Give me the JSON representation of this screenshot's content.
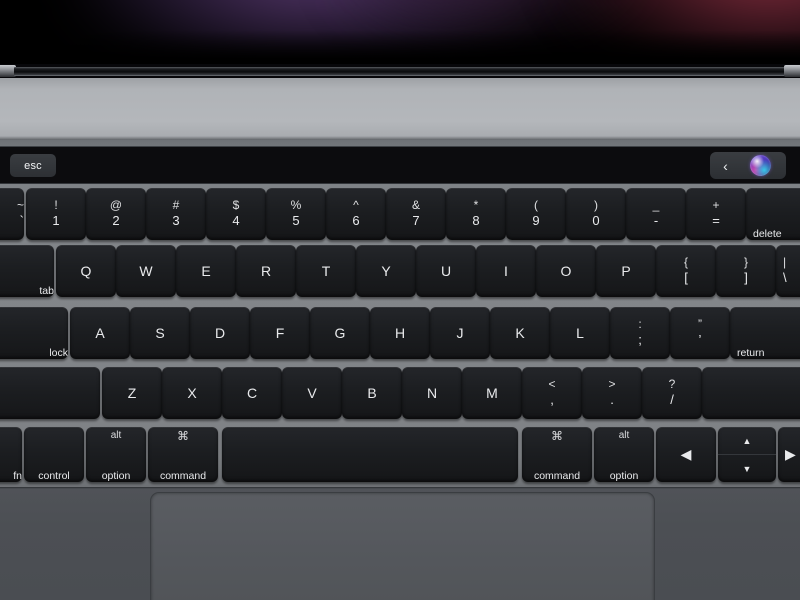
{
  "device": {
    "name": "MacBook Pro with Touch Bar",
    "screen_glow_colors": {
      "purple": "#603e78",
      "red": "#963446",
      "background": "#000000"
    },
    "body_color": "#b0b3b7",
    "deck_color": "#83868a",
    "trackpad_color": "#5a5d62"
  },
  "touchbar": {
    "esc_label": "esc",
    "back_chevron": "‹",
    "siri_label": "Siri"
  },
  "keyboard": {
    "rows": [
      {
        "name": "number-row",
        "keys": [
          {
            "name": "grave",
            "top": "~",
            "bottom": "`",
            "style": "dual",
            "clip": "left"
          },
          {
            "name": "1",
            "top": "!",
            "bottom": "1",
            "style": "dual"
          },
          {
            "name": "2",
            "top": "@",
            "bottom": "2",
            "style": "dual"
          },
          {
            "name": "3",
            "top": "#",
            "bottom": "3",
            "style": "dual"
          },
          {
            "name": "4",
            "top": "$",
            "bottom": "4",
            "style": "dual"
          },
          {
            "name": "5",
            "top": "%",
            "bottom": "5",
            "style": "dual"
          },
          {
            "name": "6",
            "top": "^",
            "bottom": "6",
            "style": "dual"
          },
          {
            "name": "7",
            "top": "&",
            "bottom": "7",
            "style": "dual"
          },
          {
            "name": "8",
            "top": "*",
            "bottom": "8",
            "style": "dual"
          },
          {
            "name": "9",
            "top": "(",
            "bottom": "9",
            "style": "dual"
          },
          {
            "name": "0",
            "top": ")",
            "bottom": "0",
            "style": "dual"
          },
          {
            "name": "minus",
            "top": "_",
            "bottom": "-",
            "style": "dual"
          },
          {
            "name": "equal",
            "top": "+",
            "bottom": "=",
            "style": "dual"
          },
          {
            "name": "delete",
            "top": "",
            "bottom": "delete",
            "style": "mod",
            "clip": "right"
          }
        ]
      },
      {
        "name": "top-letter-row",
        "keys": [
          {
            "name": "tab",
            "top": "",
            "bottom": "tab",
            "style": "mod",
            "clip": "left"
          },
          {
            "name": "q",
            "top": "",
            "bottom": "Q",
            "style": "single"
          },
          {
            "name": "w",
            "top": "",
            "bottom": "W",
            "style": "single"
          },
          {
            "name": "e",
            "top": "",
            "bottom": "E",
            "style": "single"
          },
          {
            "name": "r",
            "top": "",
            "bottom": "R",
            "style": "single"
          },
          {
            "name": "t",
            "top": "",
            "bottom": "T",
            "style": "single"
          },
          {
            "name": "y",
            "top": "",
            "bottom": "Y",
            "style": "single"
          },
          {
            "name": "u",
            "top": "",
            "bottom": "U",
            "style": "single"
          },
          {
            "name": "i",
            "top": "",
            "bottom": "I",
            "style": "single"
          },
          {
            "name": "o",
            "top": "",
            "bottom": "O",
            "style": "single"
          },
          {
            "name": "p",
            "top": "",
            "bottom": "P",
            "style": "single"
          },
          {
            "name": "bracket-left",
            "top": "{",
            "bottom": "[",
            "style": "dual"
          },
          {
            "name": "bracket-right",
            "top": "}",
            "bottom": "]",
            "style": "dual"
          },
          {
            "name": "backslash",
            "top": "|",
            "bottom": "\\",
            "style": "dual",
            "clip": "right"
          }
        ]
      },
      {
        "name": "home-row",
        "keys": [
          {
            "name": "caps-lock",
            "top": "",
            "bottom": "lock",
            "style": "mod",
            "clip": "left"
          },
          {
            "name": "a",
            "top": "",
            "bottom": "A",
            "style": "single"
          },
          {
            "name": "s",
            "top": "",
            "bottom": "S",
            "style": "single"
          },
          {
            "name": "d",
            "top": "",
            "bottom": "D",
            "style": "single"
          },
          {
            "name": "f",
            "top": "",
            "bottom": "F",
            "style": "single"
          },
          {
            "name": "g",
            "top": "",
            "bottom": "G",
            "style": "single"
          },
          {
            "name": "h",
            "top": "",
            "bottom": "H",
            "style": "single"
          },
          {
            "name": "j",
            "top": "",
            "bottom": "J",
            "style": "single"
          },
          {
            "name": "k",
            "top": "",
            "bottom": "K",
            "style": "single"
          },
          {
            "name": "l",
            "top": "",
            "bottom": "L",
            "style": "single"
          },
          {
            "name": "semicolon",
            "top": ":",
            "bottom": ";",
            "style": "dual"
          },
          {
            "name": "quote",
            "top": "”",
            "bottom": "’",
            "style": "dual"
          },
          {
            "name": "return",
            "top": "",
            "bottom": "return",
            "style": "mod",
            "clip": "right"
          }
        ]
      },
      {
        "name": "bottom-letter-row",
        "keys": [
          {
            "name": "shift-left",
            "top": "",
            "bottom": "",
            "style": "blank",
            "clip": "left"
          },
          {
            "name": "z",
            "top": "",
            "bottom": "Z",
            "style": "single"
          },
          {
            "name": "x",
            "top": "",
            "bottom": "X",
            "style": "single"
          },
          {
            "name": "c",
            "top": "",
            "bottom": "C",
            "style": "single"
          },
          {
            "name": "v",
            "top": "",
            "bottom": "V",
            "style": "single"
          },
          {
            "name": "b",
            "top": "",
            "bottom": "B",
            "style": "single"
          },
          {
            "name": "n",
            "top": "",
            "bottom": "N",
            "style": "single"
          },
          {
            "name": "m",
            "top": "",
            "bottom": "M",
            "style": "single"
          },
          {
            "name": "comma",
            "top": "<",
            "bottom": ",",
            "style": "dual"
          },
          {
            "name": "period",
            "top": ">",
            "bottom": ".",
            "style": "dual"
          },
          {
            "name": "slash",
            "top": "?",
            "bottom": "/",
            "style": "dual"
          },
          {
            "name": "shift-right",
            "top": "",
            "bottom": "",
            "style": "blank",
            "clip": "right"
          }
        ]
      },
      {
        "name": "modifier-row",
        "keys": [
          {
            "name": "fn",
            "top": "",
            "bottom": "fn",
            "style": "mod",
            "clip": "left"
          },
          {
            "name": "control",
            "top": "",
            "bottom": "control",
            "style": "mod"
          },
          {
            "name": "option-left",
            "top": "alt",
            "bottom": "option",
            "style": "mod"
          },
          {
            "name": "command-left",
            "top": "⌘",
            "bottom": "command",
            "style": "mod cmd"
          },
          {
            "name": "space",
            "top": "",
            "bottom": "",
            "style": "blank"
          },
          {
            "name": "command-right",
            "top": "⌘",
            "bottom": "command",
            "style": "mod cmd"
          },
          {
            "name": "option-right",
            "top": "alt",
            "bottom": "option",
            "style": "mod"
          },
          {
            "name": "arrow-left",
            "top": "",
            "bottom": "◀",
            "style": "single"
          },
          {
            "name": "arrow-updown",
            "top": "▲",
            "bottom": "▼",
            "style": "arrow-split"
          },
          {
            "name": "arrow-right",
            "top": "",
            "bottom": "▶",
            "style": "single",
            "clip": "right"
          }
        ]
      }
    ]
  }
}
